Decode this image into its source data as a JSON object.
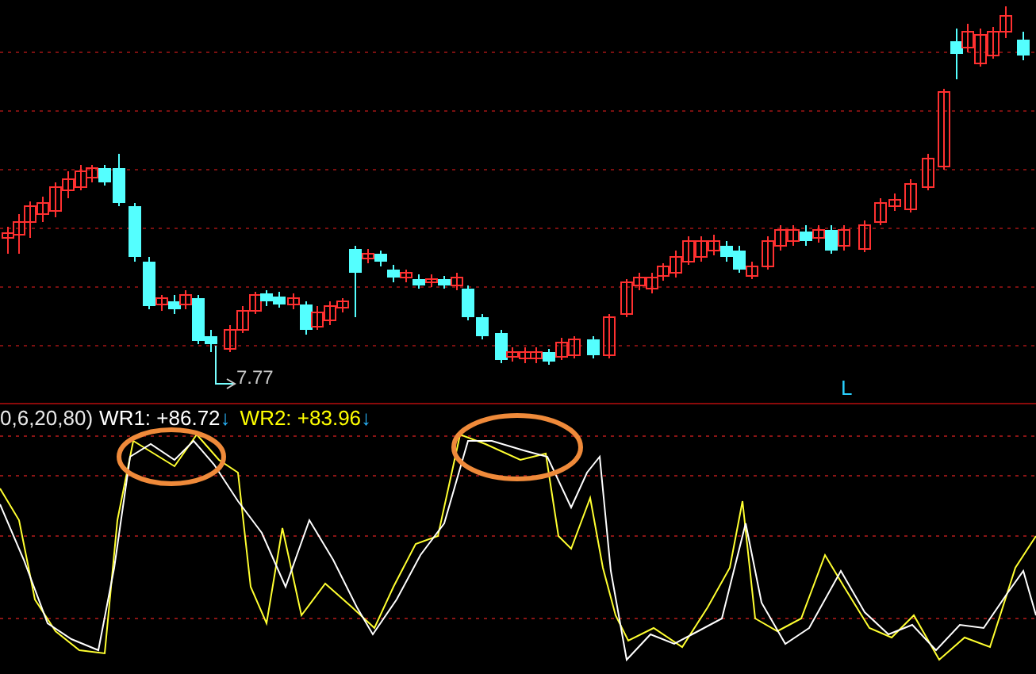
{
  "price_chart": {
    "low_label": "7.77",
    "marker": "L"
  },
  "indicator": {
    "params": "0,6,20,80)",
    "series": [
      {
        "name": "WR1:",
        "value": "+86.72",
        "arrow": "↓",
        "color": "#ffffff"
      },
      {
        "name": "WR2:",
        "value": "+83.96",
        "arrow": "↓",
        "color": "#ffff00"
      }
    ]
  }
}
